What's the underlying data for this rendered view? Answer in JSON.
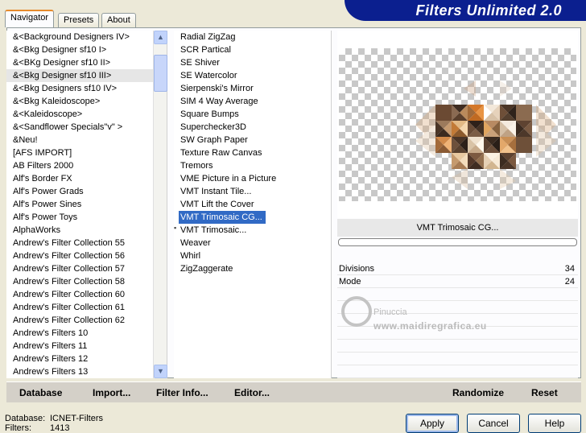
{
  "tabs": [
    {
      "label": "Navigator",
      "active": true
    },
    {
      "label": "Presets",
      "active": false
    },
    {
      "label": "About",
      "active": false
    }
  ],
  "title": "Filters Unlimited 2.0",
  "categories": {
    "selected_index": 3,
    "items": [
      "&<Background Designers IV>",
      "&<Bkg Designer sf10 I>",
      "&<BKg Designer sf10 II>",
      "&<Bkg Designer sf10 III>",
      "&<Bkg Designers sf10 IV>",
      "&<Bkg Kaleidoscope>",
      "&<Kaleidoscope>",
      "&<Sandflower Specials\"v\" >",
      "&Neu!",
      "[AFS IMPORT]",
      "AB Filters 2000",
      "Alf's Border FX",
      "Alf's Power Grads",
      "Alf's Power Sines",
      "Alf's Power Toys",
      "AlphaWorks",
      "Andrew's Filter Collection 55",
      "Andrew's Filter Collection 56",
      "Andrew's Filter Collection 57",
      "Andrew's Filter Collection 58",
      "Andrew's Filter Collection 60",
      "Andrew's Filter Collection 61",
      "Andrew's Filter Collection 62",
      "Andrew's Filters 10",
      "Andrew's Filters 11",
      "Andrew's Filters 12",
      "Andrew's Filters 13"
    ]
  },
  "filters": {
    "selected_index": 14,
    "items": [
      "Radial ZigZag",
      "SCR  Partical",
      "SE Shiver",
      "SE Watercolor",
      "Sierpenski's Mirror",
      "SIM 4 Way Average",
      "Square Bumps",
      "Superchecker3D",
      "SW Graph Paper",
      "Texture Raw Canvas",
      "Tremors",
      "VME Picture in a Picture",
      "VMT Instant Tile...",
      "VMT Lift the Cover",
      "VMT Trimosaic CG...",
      "VMT Trimosaic...",
      "Weaver",
      "Whirl",
      "ZigZaggerate"
    ]
  },
  "preview": {
    "filter_name": "VMT Trimosaic CG..."
  },
  "params": [
    {
      "label": "Divisions",
      "value": "34"
    },
    {
      "label": "Mode",
      "value": "24"
    }
  ],
  "watermark": {
    "line1": "Pinuccia",
    "line2": "www.maidiregrafica.eu"
  },
  "bottombar": {
    "database": "Database",
    "import": "Import...",
    "filter_info": "Filter Info...",
    "editor": "Editor...",
    "randomize": "Randomize",
    "reset": "Reset"
  },
  "status": {
    "database_label": "Database:",
    "database_value": "ICNET-Filters",
    "filters_label": "Filters:",
    "filters_value": "1413"
  },
  "buttons": {
    "apply": "Apply",
    "cancel": "Cancel",
    "help": "Help"
  },
  "colors": {
    "title_bar": "#0b1f8f",
    "selection": "#316ac5",
    "tab_highlight": "#e68b2c"
  }
}
